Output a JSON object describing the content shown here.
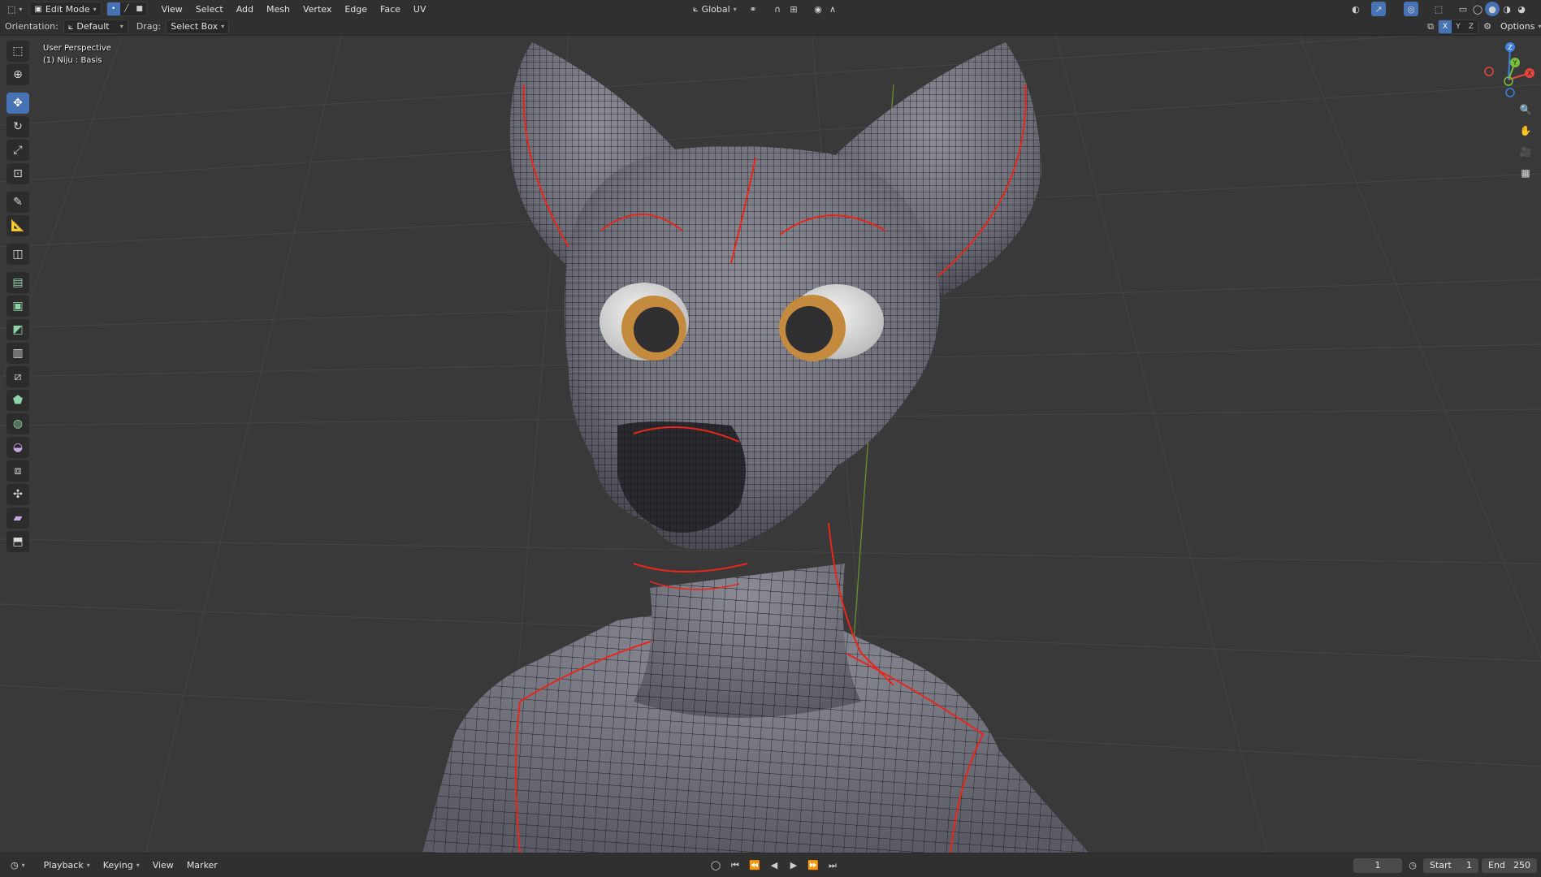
{
  "header": {
    "mode_label": "Edit Mode",
    "menus": [
      "View",
      "Select",
      "Add",
      "Mesh",
      "Vertex",
      "Edge",
      "Face",
      "UV"
    ],
    "transform_orientation": "Global",
    "options_label": "Options",
    "axis_labels": [
      "X",
      "Y",
      "Z"
    ]
  },
  "tool_settings": {
    "orientation_label": "Orientation:",
    "orientation_value": "Default",
    "drag_label": "Drag:",
    "drag_value": "Select Box"
  },
  "viewport": {
    "perspective": "User Perspective",
    "object_info": "(1) Niju : Basis"
  },
  "toolbar": {
    "tools": [
      {
        "icon": "select-box-icon",
        "active": false
      },
      {
        "icon": "cursor-icon",
        "active": false
      },
      {
        "icon": "move-icon",
        "active": true
      },
      {
        "icon": "rotate-icon",
        "active": false
      },
      {
        "icon": "scale-icon",
        "active": false
      },
      {
        "icon": "transform-icon",
        "active": false
      },
      {
        "icon": "annotate-icon",
        "active": false
      },
      {
        "icon": "measure-icon",
        "active": false
      },
      {
        "icon": "add-cube-icon",
        "active": false
      },
      {
        "icon": "extrude-icon",
        "active": false
      },
      {
        "icon": "inset-icon",
        "active": false
      },
      {
        "icon": "bevel-icon",
        "active": false
      },
      {
        "icon": "loop-cut-icon",
        "active": false
      },
      {
        "icon": "knife-icon",
        "active": false
      },
      {
        "icon": "poly-build-icon",
        "active": false
      },
      {
        "icon": "spin-icon",
        "active": false
      },
      {
        "icon": "smooth-icon",
        "active": false
      },
      {
        "icon": "edge-slide-icon",
        "active": false
      },
      {
        "icon": "shrink-fatten-icon",
        "active": false
      },
      {
        "icon": "shear-icon",
        "active": false
      },
      {
        "icon": "rip-region-icon",
        "active": false
      }
    ]
  },
  "gizmo": {
    "x": "X",
    "y": "Y",
    "z": "Z"
  },
  "timeline": {
    "menus": [
      "Playback",
      "Keying",
      "View",
      "Marker"
    ],
    "current_frame": "1",
    "start_label": "Start",
    "start_value": "1",
    "end_label": "End",
    "end_value": "250"
  },
  "colors": {
    "accent": "#4772b3",
    "header_bg": "#303030",
    "viewport_bg": "#393939",
    "seam": "#e8261c",
    "mesh": "#7a7b84"
  }
}
